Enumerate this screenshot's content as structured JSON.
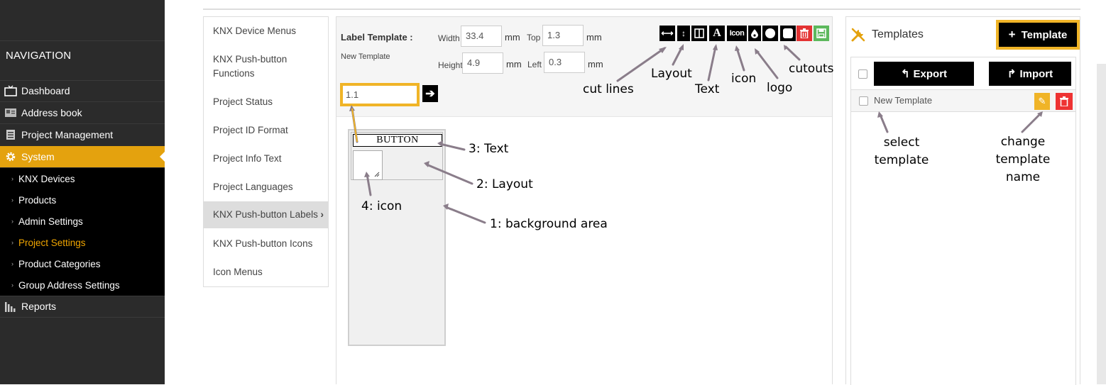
{
  "sidebar": {
    "title": "NAVIGATION",
    "items": [
      {
        "label": "Dashboard",
        "icon": "tv-icon"
      },
      {
        "label": "Address book",
        "icon": "address-book-icon"
      },
      {
        "label": "Project Management",
        "icon": "document-icon"
      },
      {
        "label": "System",
        "icon": "gear-icon",
        "active": true
      },
      {
        "label": "Reports",
        "icon": "bar-chart-icon"
      }
    ],
    "submenu": [
      {
        "label": "KNX Devices"
      },
      {
        "label": "Products"
      },
      {
        "label": "Admin Settings"
      },
      {
        "label": "Project Settings",
        "current": true
      },
      {
        "label": "Product Categories"
      },
      {
        "label": "Group Address Settings"
      }
    ]
  },
  "settings_menu": {
    "items": [
      {
        "label": "KNX Device Menus"
      },
      {
        "label": "KNX Push-button Functions"
      },
      {
        "label": "Project Status"
      },
      {
        "label": "Project ID Format"
      },
      {
        "label": "Project Info Text"
      },
      {
        "label": "Project Languages"
      },
      {
        "label": "KNX Push-button Labels",
        "active": true
      },
      {
        "label": "KNX Push-button Icons"
      },
      {
        "label": "Icon Menus"
      }
    ]
  },
  "editor": {
    "heading": "Label Template :",
    "template_name": "New Template",
    "width_label": "Width",
    "width_value": "33.4",
    "height_label": "Height",
    "height_value": "4.9",
    "top_label": "Top",
    "top_value": "1.3",
    "left_label": "Left",
    "left_value": "0.3",
    "unit": "mm",
    "field_value": "1.1",
    "preview_text": "BUTTON",
    "tools": {
      "icon_label": "Icon",
      "text_label": "A"
    }
  },
  "annotations": {
    "cut_lines": "cut lines",
    "layout": "Layout",
    "text": "Text",
    "icon": "icon",
    "logo": "logo",
    "cutouts": "cutouts",
    "p3_text": "3: Text",
    "p2_layout": "2: Layout",
    "p4_icon": "4: icon",
    "p1_background": "1: background area",
    "select_template": "select template",
    "change_template_name": "change template name"
  },
  "templates": {
    "title": "Templates",
    "add_label": "Template",
    "export_label": "Export",
    "import_label": "Import",
    "rows": [
      {
        "name": "New Template"
      }
    ]
  },
  "colors": {
    "accent": "#e4a20e",
    "highlight_border": "#f0b427",
    "delete": "#e33333",
    "save": "#5cb85c",
    "sidebar_bg": "#2b2b2b"
  }
}
